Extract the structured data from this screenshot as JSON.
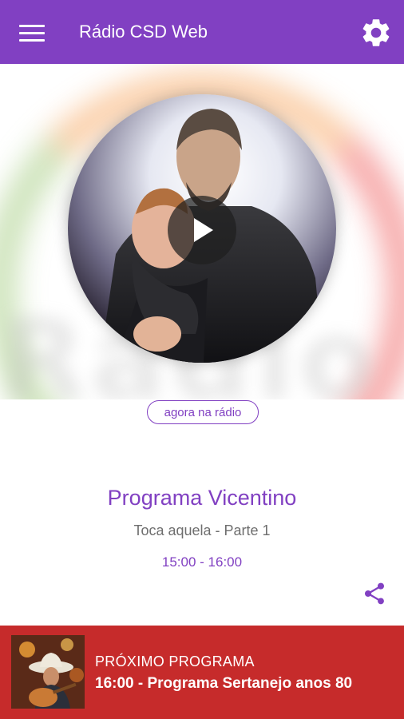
{
  "app_bar": {
    "title": "Rádio CSD Web",
    "menu_icon": "menu-icon",
    "settings_icon": "gear-icon",
    "color": "#8140c2"
  },
  "player": {
    "cover_art_description": "statue-of-saint-holding-child",
    "play_icon": "play-icon",
    "watermark_text": "Rádio CSD W"
  },
  "now_playing": {
    "badge": "agora na rádio",
    "program_title": "Programa Vicentino",
    "program_subtitle": "Toca aquela - Parte 1",
    "program_time": "15:00 - 16:00",
    "share_icon": "share-icon"
  },
  "next_program": {
    "label": "PRÓXIMO PROGRAMA",
    "program": "16:00 - Programa Sertanejo anos 80",
    "thumbnail": "guitar-player-with-hat",
    "color": "#c62b2b"
  }
}
